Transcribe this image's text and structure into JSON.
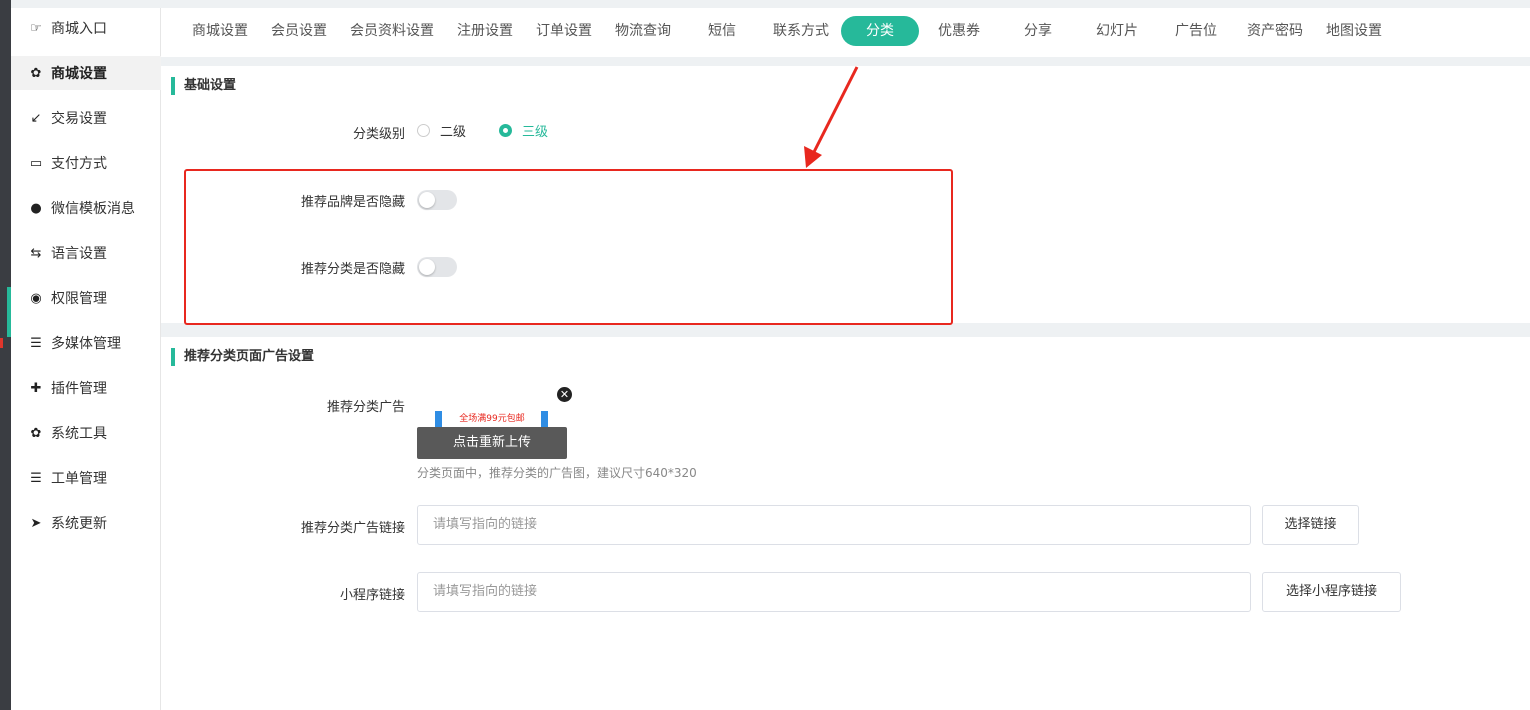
{
  "sidebar": {
    "items": [
      {
        "label": "商城入口",
        "icon": "hand-point-icon"
      },
      {
        "label": "商城设置",
        "icon": "gear-icon"
      },
      {
        "label": "交易设置",
        "icon": "compress-icon"
      },
      {
        "label": "支付方式",
        "icon": "credit-card-icon"
      },
      {
        "label": "微信模板消息",
        "icon": "wechat-icon"
      },
      {
        "label": "语言设置",
        "icon": "translate-icon"
      },
      {
        "label": "权限管理",
        "icon": "mask-icon"
      },
      {
        "label": "多媒体管理",
        "icon": "list-icon"
      },
      {
        "label": "插件管理",
        "icon": "puzzle-icon"
      },
      {
        "label": "系统工具",
        "icon": "gear-icon"
      },
      {
        "label": "工单管理",
        "icon": "list-icon"
      },
      {
        "label": "系统更新",
        "icon": "paper-plane-icon"
      }
    ]
  },
  "tabs": [
    "商城设置",
    "会员设置",
    "会员资料设置",
    "注册设置",
    "订单设置",
    "物流查询",
    "短信",
    "联系方式",
    "分类",
    "优惠券",
    "分享",
    "幻灯片",
    "广告位",
    "资产密码",
    "地图设置"
  ],
  "basic": {
    "title": "基础设置",
    "level_label": "分类级别",
    "level_options": [
      "二级",
      "三级"
    ],
    "brand_hide_label": "推荐品牌是否隐藏",
    "category_hide_label": "推荐分类是否隐藏"
  },
  "ad": {
    "title": "推荐分类页面广告设置",
    "image_label": "推荐分类广告",
    "image_watermark": "全场满99元包邮",
    "reupload_label": "点击重新上传",
    "hint": "分类页面中，推荐分类的广告图，建议尺寸640*320",
    "link_label": "推荐分类广告链接",
    "link_placeholder": "请填写指向的链接",
    "link_button": "选择链接",
    "mini_label": "小程序链接",
    "mini_placeholder": "请填写指向的链接",
    "mini_button": "选择小程序链接"
  },
  "colors": {
    "accent": "#26b99a",
    "highlight": "#e8281f"
  }
}
